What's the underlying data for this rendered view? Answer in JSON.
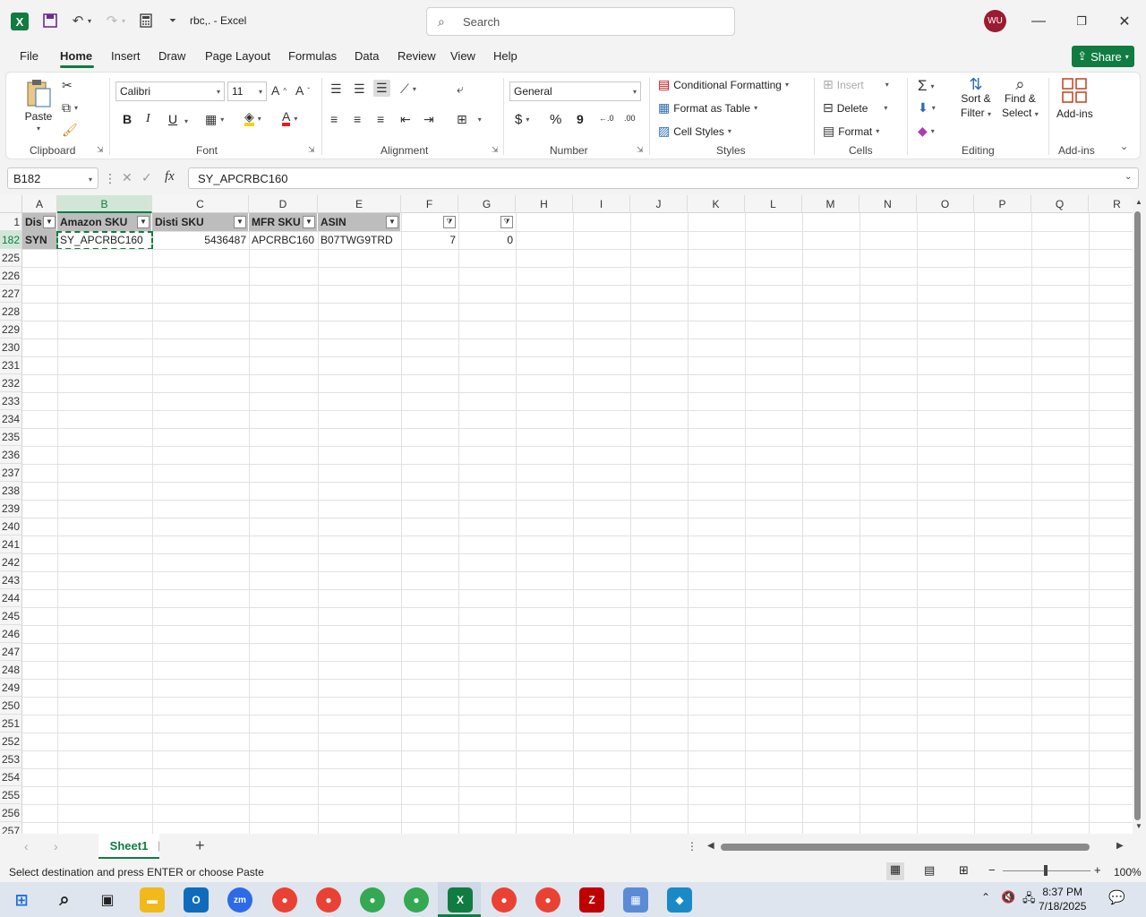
{
  "window": {
    "title": "rbc,. - Excel",
    "search_placeholder": "Search",
    "user_initials": "WU"
  },
  "menu": {
    "tabs": [
      "File",
      "Home",
      "Insert",
      "Draw",
      "Page Layout",
      "Formulas",
      "Data",
      "Review",
      "View",
      "Help"
    ],
    "active_tab": "Home",
    "share_label": "Share"
  },
  "ribbon": {
    "clipboard": {
      "label": "Clipboard",
      "paste": "Paste"
    },
    "font": {
      "label": "Font",
      "name": "Calibri",
      "size": "11",
      "bold": "B",
      "italic": "I",
      "underline": "U"
    },
    "alignment": {
      "label": "Alignment"
    },
    "number": {
      "label": "Number",
      "format": "General",
      "currency": "$",
      "percent": "%",
      "comma": "9"
    },
    "styles": {
      "label": "Styles",
      "conditional": "Conditional Formatting",
      "format_table": "Format as Table",
      "cell_styles": "Cell Styles"
    },
    "cells": {
      "label": "Cells",
      "insert": "Insert",
      "delete": "Delete",
      "format": "Format"
    },
    "editing": {
      "label": "Editing",
      "sort_filter_1": "Sort &",
      "sort_filter_2": "Filter",
      "find_select_1": "Find &",
      "find_select_2": "Select"
    },
    "addins": {
      "label": "Add-ins",
      "addins": "Add-ins"
    }
  },
  "formula_bar": {
    "name_box": "B182",
    "fx": "fx",
    "formula": "SY_APCRBC160"
  },
  "grid": {
    "columns": [
      "A",
      "B",
      "C",
      "D",
      "E",
      "F",
      "G",
      "H",
      "I",
      "J",
      "K",
      "L",
      "M",
      "N",
      "O",
      "P",
      "Q",
      "R"
    ],
    "selected_column": "B",
    "header_row": {
      "row_number": "1",
      "cells": [
        "Dis",
        "Amazon SKU",
        "Disti SKU",
        "MFR SKU",
        "ASIN",
        "",
        ""
      ]
    },
    "data_row": {
      "row_number": "182",
      "cells": [
        "SYN",
        "SY_APCRBC160",
        "5436487",
        "APCRBC160",
        "B07TWG9TRD",
        "7",
        "0"
      ]
    },
    "empty_rows": [
      "225",
      "226",
      "227",
      "228",
      "229",
      "230",
      "231",
      "232",
      "233",
      "234",
      "235",
      "236",
      "237",
      "238",
      "239",
      "240",
      "241",
      "242",
      "243",
      "244",
      "245",
      "246",
      "247",
      "248",
      "249",
      "250",
      "251",
      "252",
      "253",
      "254",
      "255",
      "256",
      "257"
    ]
  },
  "sheets": {
    "tabs": [
      "Sheet1"
    ],
    "active": "Sheet1"
  },
  "status": {
    "message": "Select destination and press ENTER or choose Paste",
    "zoom": "100%"
  },
  "taskbar": {
    "time": "8:37 PM",
    "date": "7/18/2025"
  },
  "colors": {
    "accent": "#107c41",
    "header_fill": "#bdbdbd"
  }
}
